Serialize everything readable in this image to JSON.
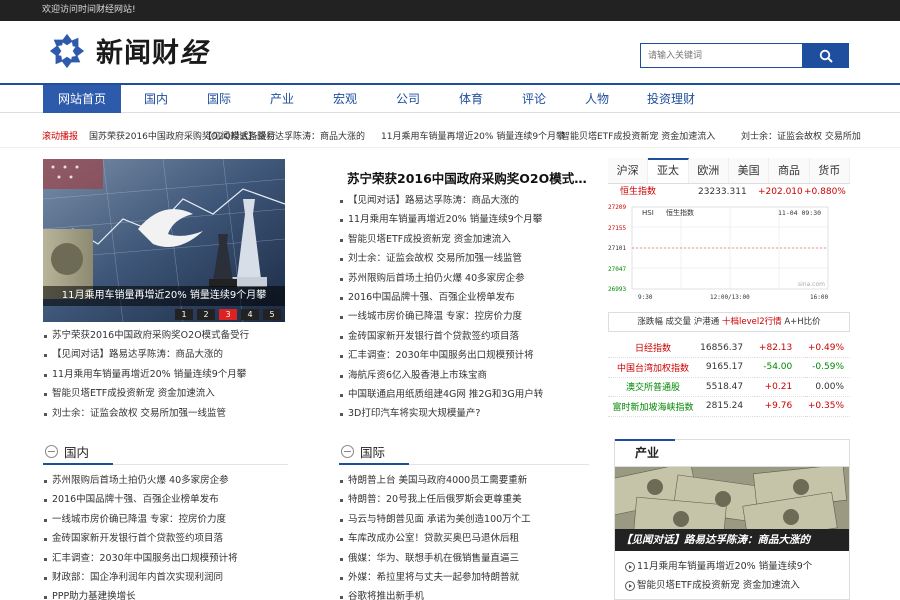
{
  "topbar": {
    "welcome": "欢迎访问时间财经网站!"
  },
  "brand": {
    "name_main": "新闻财",
    "name_tail": "经"
  },
  "search": {
    "placeholder": "请输入关键词"
  },
  "nav": [
    "网站首页",
    "国内",
    "国际",
    "产业",
    "宏观",
    "公司",
    "体育",
    "评论",
    "人物",
    "投资理财"
  ],
  "ticker": {
    "label": "滚动播报",
    "items": [
      "国苏荣获2016中国政府采购奖O2O模式备受行",
      "【见闻对话】路易达孚陈涛：商品大涨的",
      "11月乘用车销量再增近20% 销量连续9个月攀",
      "智能贝塔ETF成投资新宠 资金加速流入",
      "刘士余：证监会故权 交易所加"
    ]
  },
  "slider": {
    "caption": "11月乘用车销量再增近20% 销量连续9个月攀",
    "dots": [
      "1",
      "2",
      "3",
      "4",
      "5"
    ]
  },
  "slider_list": [
    "苏宁荣获2016中国政府采购奖O2O模式备受行",
    "【见闻对话】路易达孚陈涛：商品大涨的",
    "11月乘用车销量再增近20% 销量连续9个月攀",
    "智能贝塔ETF成投资新宠 资金加速流入",
    "刘士余：证监会故权 交易所加强一线监管"
  ],
  "headline": "苏宁荣获2016中国政府采购奖O2O模式…",
  "headline_list": [
    "【见闻对话】路易达孚陈涛：商品大涨的",
    "11月乘用车销量再增近20% 销量连续9个月攀",
    "智能贝塔ETF成投资新宠 资金加速流入",
    "刘士余：证监会故权 交易所加强一线监管",
    "苏州限购后首场土拍仍火爆 40多家房企参",
    "2016中国品牌十强、百强企业榜单发布",
    "一线城市房价确已降温 专家：控房价力度",
    "金砖国家新开发银行首个贷款签约项目落",
    "汇丰调查：2030年中国服务出口规模预计将",
    "海航斥资6亿入股香港上市珠宝商",
    "中国联通启用纸质组建4G网 推2G和3G用户转",
    "3D打印汽车将实现大规模量产?"
  ],
  "domestic": {
    "title": "国内",
    "items": [
      "苏州限购后首场土拍仍火爆 40多家房企参",
      "2016中国品牌十强、百强企业榜单发布",
      "一线城市房价确已降温 专家：控房价力度",
      "金砖国家新开发银行首个贷款签约项目落",
      "汇丰调查：2030年中国服务出口规模预计将",
      "财政部：国企净利润年内首次实现利润同",
      "PPP助力基建换增长"
    ]
  },
  "international": {
    "title": "国际",
    "items": [
      "特朗普上台 美国马政府4000员工需要重新",
      "特朗普：20号我上任后俄罗斯会更尊重美",
      "马云与特朗普见面 承诺为美创造100万个工",
      "车库改成办公室！贷款买奥巴马退休后租",
      "俄媒：华为、联想手机在俄销售量直逼三",
      "外媒：希拉里将与丈夫一起参加特朗普就",
      "谷歌将推出新手机"
    ]
  },
  "market": {
    "tabs": [
      "沪深",
      "亚太",
      "欧洲",
      "美国",
      "商品",
      "货币"
    ],
    "active_tab": "亚太",
    "hsi": {
      "name": "恒生指数",
      "value": "23233.311",
      "change": "+202.010",
      "pct": "+0.880%"
    },
    "chart_label_code": "HSI",
    "chart_label_name": "恒生指数",
    "chart_date": "11-04 09:30",
    "y_ticks": [
      "27209",
      "27155",
      "27101",
      "27047",
      "26993"
    ],
    "x_ticks": [
      "9:30",
      "12:00/13:00",
      "16:00"
    ],
    "watermark": "sina.com",
    "links": {
      "a": "涨跌幅",
      "b": "成交量",
      "c": "沪港通",
      "d": "十档level2行情",
      "e": "A+H比价"
    },
    "indices": [
      {
        "name": "日经指数",
        "value": "16856.37",
        "change": "+82.13",
        "pct": "+0.49%"
      },
      {
        "name": "中国台湾加权指数",
        "value": "9165.17",
        "change": "-54.00",
        "pct": "-0.59%"
      },
      {
        "name": "澳交所普通股",
        "value": "5518.47",
        "change": "+0.21",
        "pct": "0.00%"
      },
      {
        "name": "富时新加坡海峡指数",
        "value": "2815.24",
        "change": "+9.76",
        "pct": "+0.35%"
      }
    ]
  },
  "industry": {
    "title": "产业",
    "caption": "【见闻对话】路易达孚陈涛：商品大涨的",
    "items": [
      "11月乘用车销量再增近20% 销量连续9个",
      "智能贝塔ETF成投资新宠 资金加速流入"
    ]
  },
  "colors": {
    "brand_blue": "#1f4e9e",
    "up_red": "#cc0000",
    "down_green": "#008800"
  }
}
